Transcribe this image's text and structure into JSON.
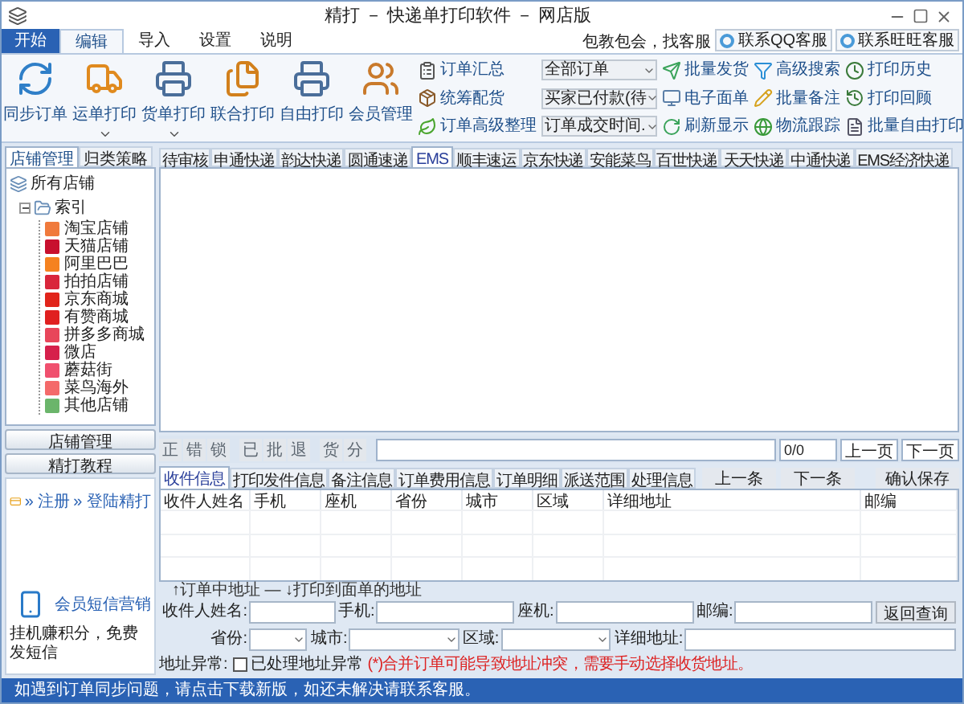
{
  "window": {
    "title": "精打 － 快递单打印软件 － 网店版"
  },
  "ribbon": {
    "file_tab": "开始",
    "tabs": [
      {
        "label": "编辑",
        "selected": true
      },
      {
        "label": "导入",
        "selected": false
      },
      {
        "label": "设置",
        "selected": false
      },
      {
        "label": "说明",
        "selected": false
      }
    ],
    "help_text": "包教包会，找客服",
    "contact_buttons": [
      "联系QQ客服",
      "联系旺旺客服"
    ],
    "large_buttons": [
      {
        "label": "同步订单",
        "has_menu": false
      },
      {
        "label": "运单打印",
        "has_menu": true
      },
      {
        "label": "货单打印",
        "has_menu": true
      },
      {
        "label": "联合打印",
        "has_menu": false
      },
      {
        "label": "自由打印",
        "has_menu": false
      },
      {
        "label": "会员管理",
        "has_menu": false
      }
    ],
    "order_tools": [
      "订单汇总",
      "统筹配货",
      "订单高级整理"
    ],
    "filters": [
      {
        "value": "全部订单"
      },
      {
        "value": "买家已付款(待"
      },
      {
        "value": "订单成交时间."
      }
    ],
    "batch_tools": [
      "批量发货",
      "电子面单",
      "刷新显示"
    ],
    "search_tools": [
      "高级搜索",
      "批量备注",
      "物流跟踪"
    ],
    "history_tools": [
      "打印历史",
      "打印回顾",
      "批量自由打印"
    ]
  },
  "left_panel": {
    "tabs": [
      {
        "label": "店铺管理",
        "selected": true
      },
      {
        "label": "归类策略",
        "selected": false
      }
    ],
    "tree": {
      "label": "所有店铺",
      "children": [
        {
          "label": "索引",
          "expanded": true,
          "children": [
            {
              "label": "淘宝店铺",
              "color": "#f07a3c"
            },
            {
              "label": "天猫店铺",
              "color": "#c8102e"
            },
            {
              "label": "阿里巴巴",
              "color": "#f58220"
            },
            {
              "label": "拍拍店铺",
              "color": "#d9263b"
            },
            {
              "label": "京东商城",
              "color": "#e1251b"
            },
            {
              "label": "有赞商城",
              "color": "#e02020"
            },
            {
              "label": "拼多多商城",
              "color": "#e8465a"
            },
            {
              "label": "微店",
              "color": "#d6204b"
            },
            {
              "label": "蘑菇街",
              "color": "#f0506e"
            },
            {
              "label": "菜鸟海外",
              "color": "#f46a6a"
            },
            {
              "label": "其他店铺",
              "color": "#6bb56b"
            }
          ]
        }
      ]
    },
    "buttons": [
      "店铺管理",
      "精打教程"
    ],
    "links": [
      "» 注册",
      "» 登陆精打"
    ],
    "sms": "会员短信营销",
    "promo": "挂机赚积分，免费发短信"
  },
  "carrier_tabs": [
    {
      "label": "待审核",
      "selected": false
    },
    {
      "label": "申通快递",
      "selected": false
    },
    {
      "label": "韵达快递",
      "selected": false
    },
    {
      "label": "圆通速递",
      "selected": false
    },
    {
      "label": "EMS",
      "selected": true
    },
    {
      "label": "顺丰速运",
      "selected": false
    },
    {
      "label": "京东快递",
      "selected": false
    },
    {
      "label": "安能菜鸟",
      "selected": false
    },
    {
      "label": "百世快递",
      "selected": false
    },
    {
      "label": "天天快递",
      "selected": false
    },
    {
      "label": "中通快递",
      "selected": false
    },
    {
      "label": "EMS经济快递",
      "selected": false
    }
  ],
  "toolbar": {
    "tool_groups": [
      [
        {
          "label": "正",
          "disabled": true
        },
        {
          "label": "错",
          "disabled": true
        },
        {
          "label": "锁",
          "disabled": true
        }
      ],
      [
        {
          "label": "已",
          "disabled": true
        },
        {
          "label": "批",
          "disabled": true
        },
        {
          "label": "退",
          "disabled": true
        }
      ],
      [
        {
          "label": "货",
          "disabled": true
        },
        {
          "label": "分",
          "disabled": true
        }
      ]
    ],
    "page_count": "0/0",
    "pager": [
      "上一页",
      "下一页"
    ]
  },
  "detail": {
    "tabs": [
      {
        "label": "收件信息",
        "selected": true
      },
      {
        "label": "打印发件信息",
        "selected": false
      },
      {
        "label": "备注信息",
        "selected": false
      },
      {
        "label": "订单费用信息",
        "selected": false
      },
      {
        "label": "订单明细",
        "selected": false
      },
      {
        "label": "派送范围",
        "selected": false
      },
      {
        "label": "处理信息",
        "selected": false
      }
    ],
    "nav_buttons": [
      "上一条",
      "下一条"
    ],
    "save_button": "确认保存",
    "table": {
      "columns": [
        "收件人姓名",
        "手机",
        "座机",
        "省份",
        "城市",
        "区域",
        "详细地址",
        "邮编"
      ]
    },
    "legend": "↑订单中地址 — ↓打印到面单的地址",
    "form_rows": [
      [
        {
          "label": "收件人姓名:",
          "kind": "text"
        },
        {
          "label": "手机:",
          "kind": "text"
        },
        {
          "label": "座机:",
          "kind": "text"
        },
        {
          "label": "邮编:",
          "kind": "text"
        },
        {
          "label": "返回查询",
          "kind": "button"
        }
      ],
      [
        {
          "label": "省份:",
          "kind": "select"
        },
        {
          "label": "城市:",
          "kind": "select"
        },
        {
          "label": "区域:",
          "kind": "select"
        },
        {
          "label": "详细地址:",
          "kind": "wide"
        }
      ]
    ],
    "address_label": "地址异常:",
    "checkbox": {
      "label": "已处理地址异常",
      "checked": false
    },
    "warning": "(*)合并订单可能导致地址冲突，需要手动选择收货地址。"
  },
  "status_bar": "如遇到订单同步问题，请点击下载新版，如还未解决请联系客服。"
}
